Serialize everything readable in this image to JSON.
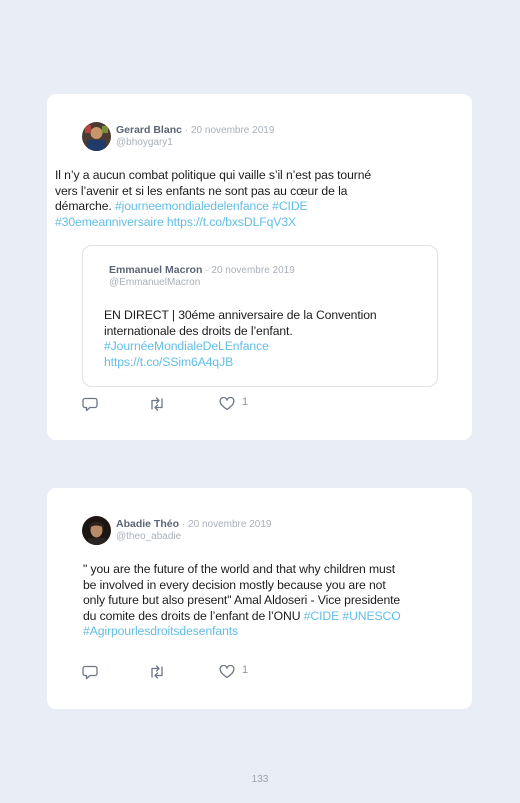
{
  "tweets": [
    {
      "author": "Gerard Blanc",
      "date": "· 20 novembre 2019",
      "handle": "@bhoygary1",
      "text_lines": [
        "Il n’y a aucun combat politique qui vaille s’il n’est pas tourné",
        "vers l’avenir et si les enfants ne sont pas au cœur de la"
      ],
      "text_line3_plain": "démarche. ",
      "text_line3_link": "#journeemondialedelenfance #CIDE",
      "text_line4_link": "#30emeanniversaire https://t.co/bxsDLFqV3X",
      "quoted": {
        "author": "Emmanuel Macron",
        "date": "· 20 novembre 2019",
        "handle": "@EmmanuelMacron",
        "text_lines": [
          "EN DIRECT | 30éme anniversaire de la Convention",
          "internationale des droits de l’enfant."
        ],
        "link_lines": [
          "#JournéeMondialeDeLEnfance",
          "https://t.co/SSim6A4qJB"
        ]
      },
      "likes": "1"
    },
    {
      "author": "Abadie Théo",
      "date": "· 20 novembre 2019",
      "handle": "@theo_abadie",
      "text_lines": [
        "\" you are the future of the world and that why children must",
        "be involved in every decision mostly because you are not",
        "only future but also present\" Amal Aldoseri - Vice presidente"
      ],
      "text_line4_plain": "du comite des droits de l’enfant de l’ONU ",
      "text_line4_link": "#CIDE #UNESCO",
      "text_line5_link": "#Agirpourlesdroitsdesenfants",
      "likes": "1"
    }
  ],
  "page_number": "133",
  "colors": {
    "background": "#e8edf6",
    "link": "#62bde6",
    "name": "#5b6575",
    "muted": "#a9b0bb"
  },
  "icons": [
    "reply-icon",
    "retweet-icon",
    "heart-icon"
  ]
}
